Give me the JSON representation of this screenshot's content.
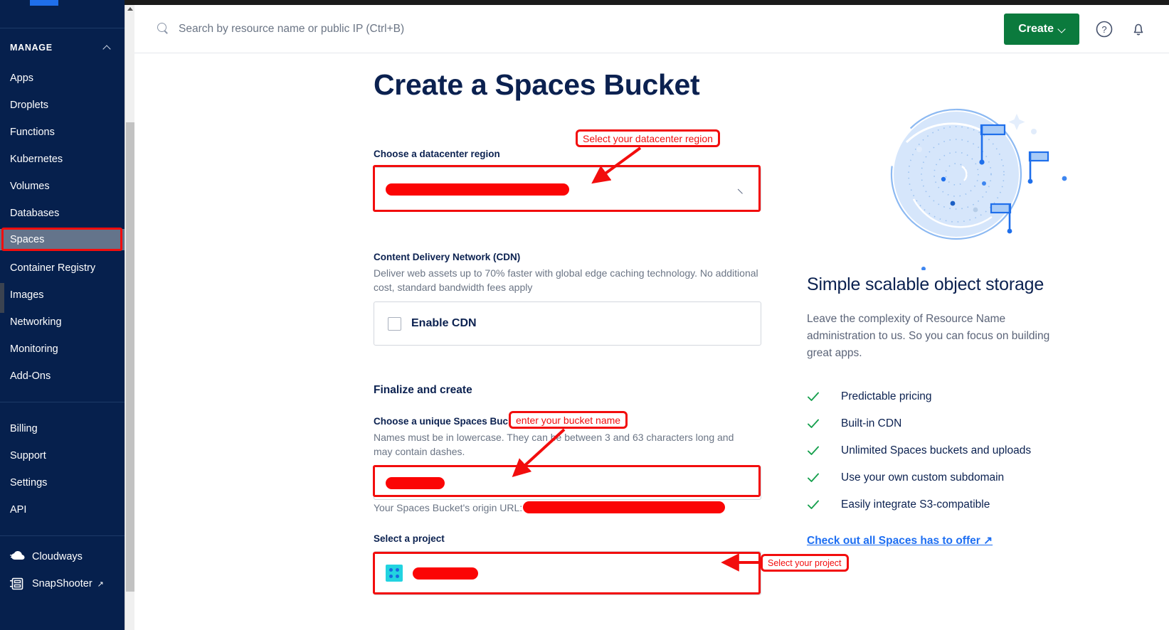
{
  "sidebar": {
    "section_title": "MANAGE",
    "manage_items": [
      {
        "label": "Apps"
      },
      {
        "label": "Droplets"
      },
      {
        "label": "Functions"
      },
      {
        "label": "Kubernetes"
      },
      {
        "label": "Volumes"
      },
      {
        "label": "Databases"
      },
      {
        "label": "Spaces"
      },
      {
        "label": "Container Registry"
      },
      {
        "label": "Images"
      },
      {
        "label": "Networking"
      },
      {
        "label": "Monitoring"
      },
      {
        "label": "Add-Ons"
      }
    ],
    "account_items": [
      {
        "label": "Billing"
      },
      {
        "label": "Support"
      },
      {
        "label": "Settings"
      },
      {
        "label": "API"
      }
    ],
    "product_items": [
      {
        "label": "Cloudways",
        "external": ""
      },
      {
        "label": "SnapShooter",
        "external": "↗"
      }
    ],
    "active_item": "Spaces"
  },
  "header": {
    "search_placeholder": "Search by resource name or public IP (Ctrl+B)",
    "create_label": "Create",
    "help_icon": "question-circle-icon",
    "bell_icon": "notification-bell-icon"
  },
  "main": {
    "page_title": "Create a Spaces Bucket",
    "region": {
      "label": "Choose a datacenter region",
      "value": "",
      "redacted": true
    },
    "cdn": {
      "label": "Content Delivery Network (CDN)",
      "description": "Deliver web assets up to 70% faster with global edge caching technology. No additional cost, standard bandwidth fees apply",
      "checkbox_label": "Enable CDN",
      "checked": false
    },
    "finalize": {
      "section_label": "Finalize and create",
      "bucket_label": "Choose a unique Spaces Bucket name",
      "bucket_description": "Names must be in lowercase. They can be between 3 and 63 characters long and may contain dashes.",
      "bucket_value": "",
      "origin_prefix": "Your Spaces Bucket's origin URL:",
      "origin_value": ""
    },
    "project": {
      "label": "Select a project",
      "value": "",
      "avatar_icon": "project-dots-icon"
    }
  },
  "promo": {
    "illustration": "object-storage-radar-illustration",
    "title": "Simple scalable object storage",
    "body": "Leave the complexity of Resource Name administration to us. So you can focus on building great apps.",
    "features": [
      "Predictable pricing",
      "Built-in CDN",
      "Unlimited Spaces buckets and uploads",
      "Use your own custom subdomain",
      "Easily integrate S3-compatible"
    ],
    "link_text": "Check out all Spaces has to offer ↗"
  },
  "annotations": [
    {
      "id": "region-anno",
      "text": "Select your datacenter region"
    },
    {
      "id": "bucket-anno",
      "text": "enter your bucket name"
    },
    {
      "id": "project-anno",
      "text": "Select your project"
    }
  ],
  "colors": {
    "sidebar_bg": "#06204d",
    "accent_green": "#0b7a3d",
    "annotation_red": "#f20d0d",
    "title_navy": "#0b2150",
    "link_blue": "#1d6ef2"
  }
}
